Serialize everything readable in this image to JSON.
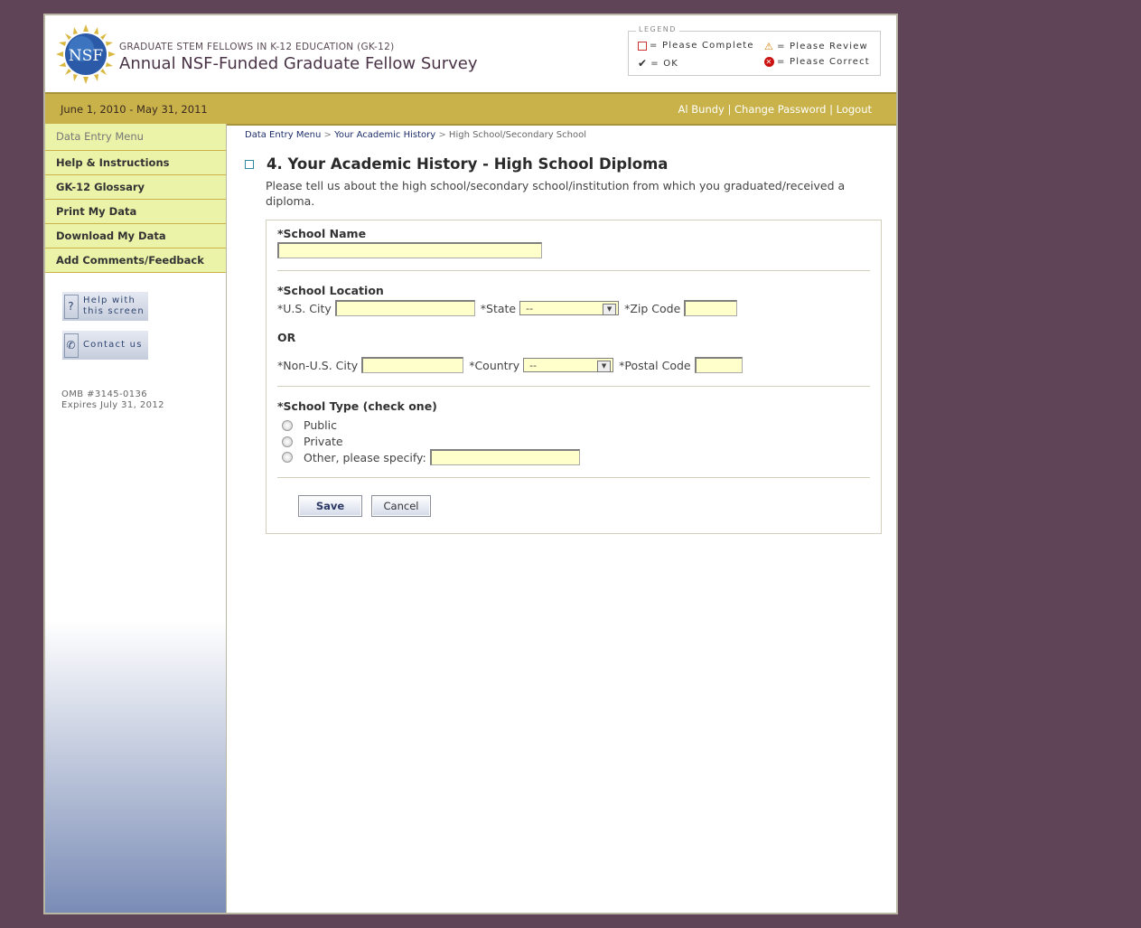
{
  "header": {
    "logo_text": "NSF",
    "subtitle": "GRADUATE STEM FELLOWS IN K-12 EDUCATION (GK-12)",
    "title": "Annual NSF-Funded Graduate Fellow Survey"
  },
  "legend": {
    "title": "LEGEND",
    "items": [
      {
        "icon": "empty-box-icon",
        "label": "= Please Complete"
      },
      {
        "icon": "warning-icon",
        "label": "= Please Review"
      },
      {
        "icon": "checkmark-icon",
        "label": "= OK"
      },
      {
        "icon": "error-icon",
        "label": "= Please Correct"
      }
    ]
  },
  "topbar": {
    "dates": "June 1, 2010 - May 31, 2011",
    "user": "Al Bundy",
    "sep": "|",
    "change_password": "Change Password",
    "logout": "Logout"
  },
  "sidebar": {
    "items": [
      "Data Entry Menu",
      "Help & Instructions",
      "GK-12 Glossary",
      "Print My Data",
      "Download My Data",
      "Add Comments/Feedback"
    ],
    "help_line1": "Help with",
    "help_line2": "this screen",
    "contact": "Contact us",
    "omb": "OMB #3145-0136",
    "expires": "Expires July 31, 2012"
  },
  "breadcrumb": {
    "items": [
      "Data Entry Menu",
      "Your Academic History",
      "High School/Secondary School"
    ],
    "sep": ">"
  },
  "page": {
    "title": "4. Your Academic History - High School Diploma",
    "intro": "Please tell us about the high school/secondary school/institution from which you graduated/received a diploma."
  },
  "form": {
    "school_name_label": "*School Name",
    "school_name_value": "",
    "location_label": "*School Location",
    "us_city_label": "*U.S. City",
    "state_label": "*State",
    "state_value": "--",
    "zip_label": "*Zip Code",
    "or_label": "OR",
    "nonus_city_label": "*Non-U.S. City",
    "country_label": "*Country",
    "country_value": "--",
    "postal_label": "*Postal Code",
    "type_label": "*School Type (check one)",
    "type_options": [
      "Public",
      "Private",
      "Other, please specify:"
    ],
    "save": "Save",
    "cancel": "Cancel"
  }
}
